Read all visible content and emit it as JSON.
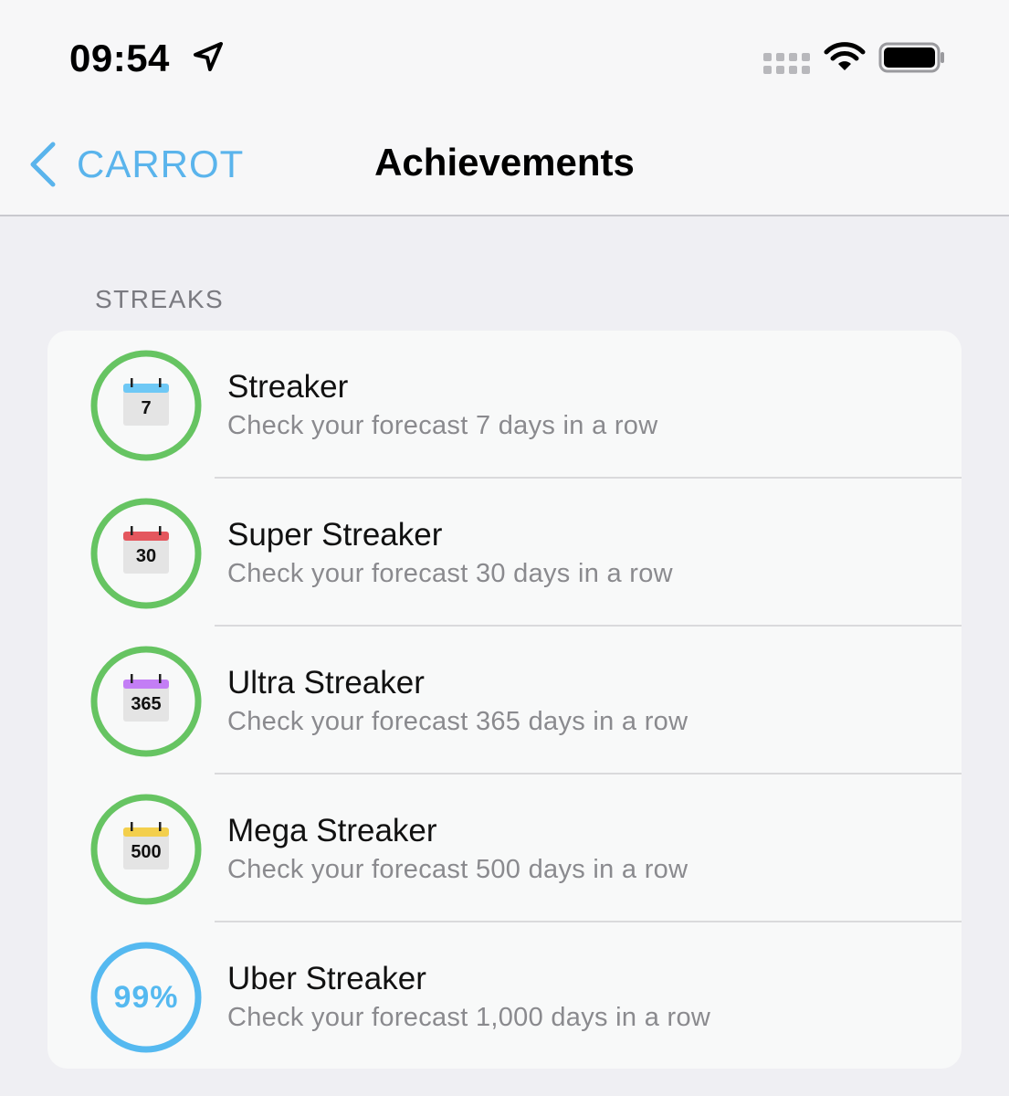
{
  "status_bar": {
    "time": "09:54",
    "icons": [
      "location-arrow-icon",
      "cellular-signal-icon",
      "wifi-icon",
      "battery-icon"
    ]
  },
  "nav": {
    "back_label": "CARROT",
    "title": "Achievements",
    "accent_color": "#5ab4ec"
  },
  "section": {
    "header": "STREAKS"
  },
  "achievements": [
    {
      "title": "Streaker",
      "subtitle": "Check your forecast 7 days in a row",
      "badge_number": "7",
      "calendar_color": "#6ec8f5",
      "ring_color": "#66c462",
      "completed": true
    },
    {
      "title": "Super Streaker",
      "subtitle": "Check your forecast 30 days in a row",
      "badge_number": "30",
      "calendar_color": "#e4575e",
      "ring_color": "#66c462",
      "completed": true
    },
    {
      "title": "Ultra Streaker",
      "subtitle": "Check your forecast 365 days in a row",
      "badge_number": "365",
      "calendar_color": "#c37ef5",
      "ring_color": "#66c462",
      "completed": true
    },
    {
      "title": "Mega Streaker",
      "subtitle": "Check your forecast 500 days in a row",
      "badge_number": "500",
      "calendar_color": "#f3cf4c",
      "ring_color": "#66c462",
      "completed": true
    },
    {
      "title": "Uber Streaker",
      "subtitle": "Check your forecast 1,000 days in a row",
      "progress_label": "99%",
      "progress": 0.99,
      "ring_color": "#55b9f0",
      "completed": false
    }
  ]
}
